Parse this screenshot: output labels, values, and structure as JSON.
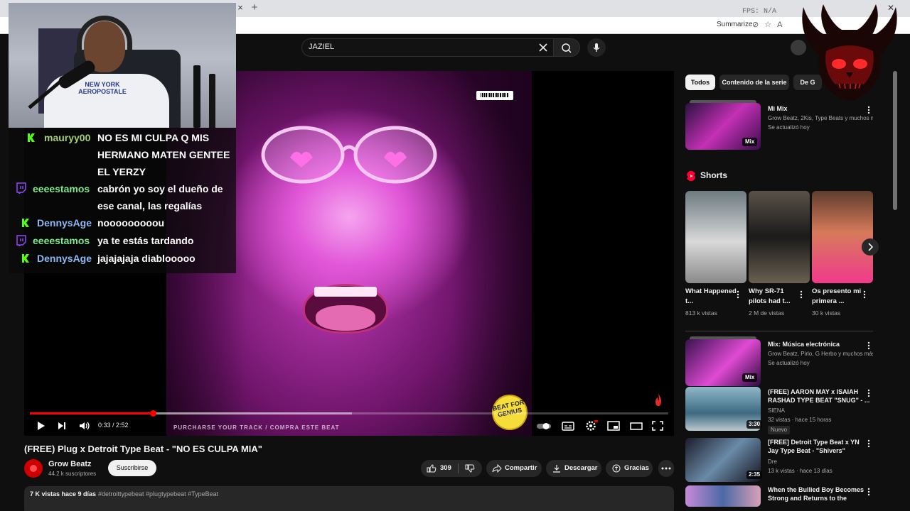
{
  "browser": {
    "fps_label": "FPS: N/A",
    "summarize_label": "Summarize",
    "tab_close": "×",
    "new_tab": "+"
  },
  "search": {
    "query": "JAZIEL"
  },
  "player": {
    "current_time": "0:33",
    "duration": "2:52",
    "time_display": "0:33 / 2:52",
    "progress_fraction": 0.193,
    "buffer_fraction": 0.505,
    "overlay_purchase_text": "PURCHARSE YOUR TRACK / COMPRA ESTE BEAT",
    "badge_text": "BEAT FOR GENIUS"
  },
  "video": {
    "title": "(FREE) Plug x Detroit Type Beat - \"NO ES CULPA MIA\"",
    "channel_name": "Grow Beatz",
    "subscribers": "44.2 k suscriptores",
    "subscribe_label": "Suscribirse",
    "likes": "309",
    "share_label": "Compartir",
    "download_label": "Descargar",
    "thanks_label": "Gracias",
    "views_date": "7 K vistas  hace 9 días",
    "tags": "#detroittypebeat #plugtypebeat #TypeBeat"
  },
  "sidebar": {
    "chips": [
      "Todos",
      "Contenido de la serie",
      "De G"
    ],
    "mix1": {
      "title": "Mi Mix",
      "meta1": "Grow Beatz, 2Kis, Type Beats y muchos más",
      "meta2": "Se actualizó hoy",
      "badge": "Mix"
    },
    "shorts_heading": "Shorts",
    "shorts": [
      {
        "title": "What Happened t...",
        "views": "813 k vistas"
      },
      {
        "title": "Why SR-71 pilots had t...",
        "views": "2 M de vistas"
      },
      {
        "title": "Os presento mi primera ...",
        "views": "30 k vistas"
      }
    ],
    "mix2": {
      "title": "Mix: Música electrónica",
      "meta1": "Grow Beatz, Pirlo, G Herbo y muchos más",
      "meta2": "Se actualizó hoy",
      "badge": "Mix"
    },
    "videos": [
      {
        "title": "(FREE) AARON MAY x ISAIAH RASHAD TYPE BEAT \"SNUG\" - ...",
        "channel": "SIENA",
        "meta": "32 vistas · hace 15 horas",
        "duration": "3:30",
        "badge": "Nuevo"
      },
      {
        "title": "[FREE] Detroit Type Beat x YN Jay Type Beat - \"Shivers\"",
        "channel": "Dre",
        "meta": "13 k vistas · hace 13 días",
        "duration": "2:35"
      },
      {
        "title": "When the Bullied Boy Becomes Strong and Returns to the",
        "channel": "",
        "meta": "",
        "duration": ""
      }
    ]
  },
  "webcam": {
    "shirt_print": "NEW YORK AEROPOSTALE"
  },
  "chat": [
    {
      "user": "mauryy00",
      "platform": "kick",
      "message": "NO ES MI CULPA Q MIS HERMANO MATEN GENTEE EL YERZY"
    },
    {
      "user": "eeeestamos",
      "platform": "twitch",
      "message": "cabrón yo soy el dueño de ese canal, las regalías"
    },
    {
      "user": "DennysAge",
      "platform": "kick",
      "message": "nooooooooou"
    },
    {
      "user": "eeeestamos",
      "platform": "twitch",
      "message": "ya te estás tardando"
    },
    {
      "user": "DennysAge",
      "platform": "kick",
      "message": "jajajajaja diablooooo"
    }
  ],
  "colors": {
    "accent_red": "#ff0000",
    "kick_green": "#53fc18",
    "twitch_purple": "#9146ff",
    "background": "#0f0f0f"
  }
}
